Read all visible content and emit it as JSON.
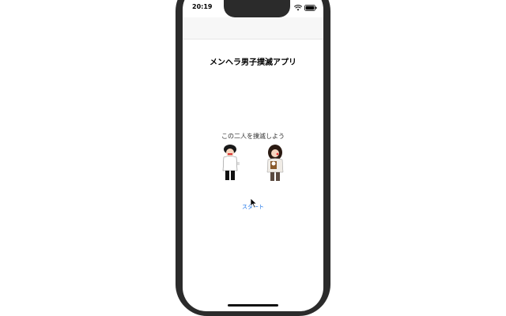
{
  "status_bar": {
    "time": "20:19",
    "icons": [
      "wifi-icon",
      "battery-icon"
    ]
  },
  "app": {
    "title": "メンヘラ男子撲滅アプリ",
    "subtitle": "この二人を撲滅しよう",
    "start_label": "スタート"
  },
  "colors": {
    "frame": "#2b2b2b",
    "link": "#1a73e8",
    "navbar": "#f7f7f7"
  }
}
